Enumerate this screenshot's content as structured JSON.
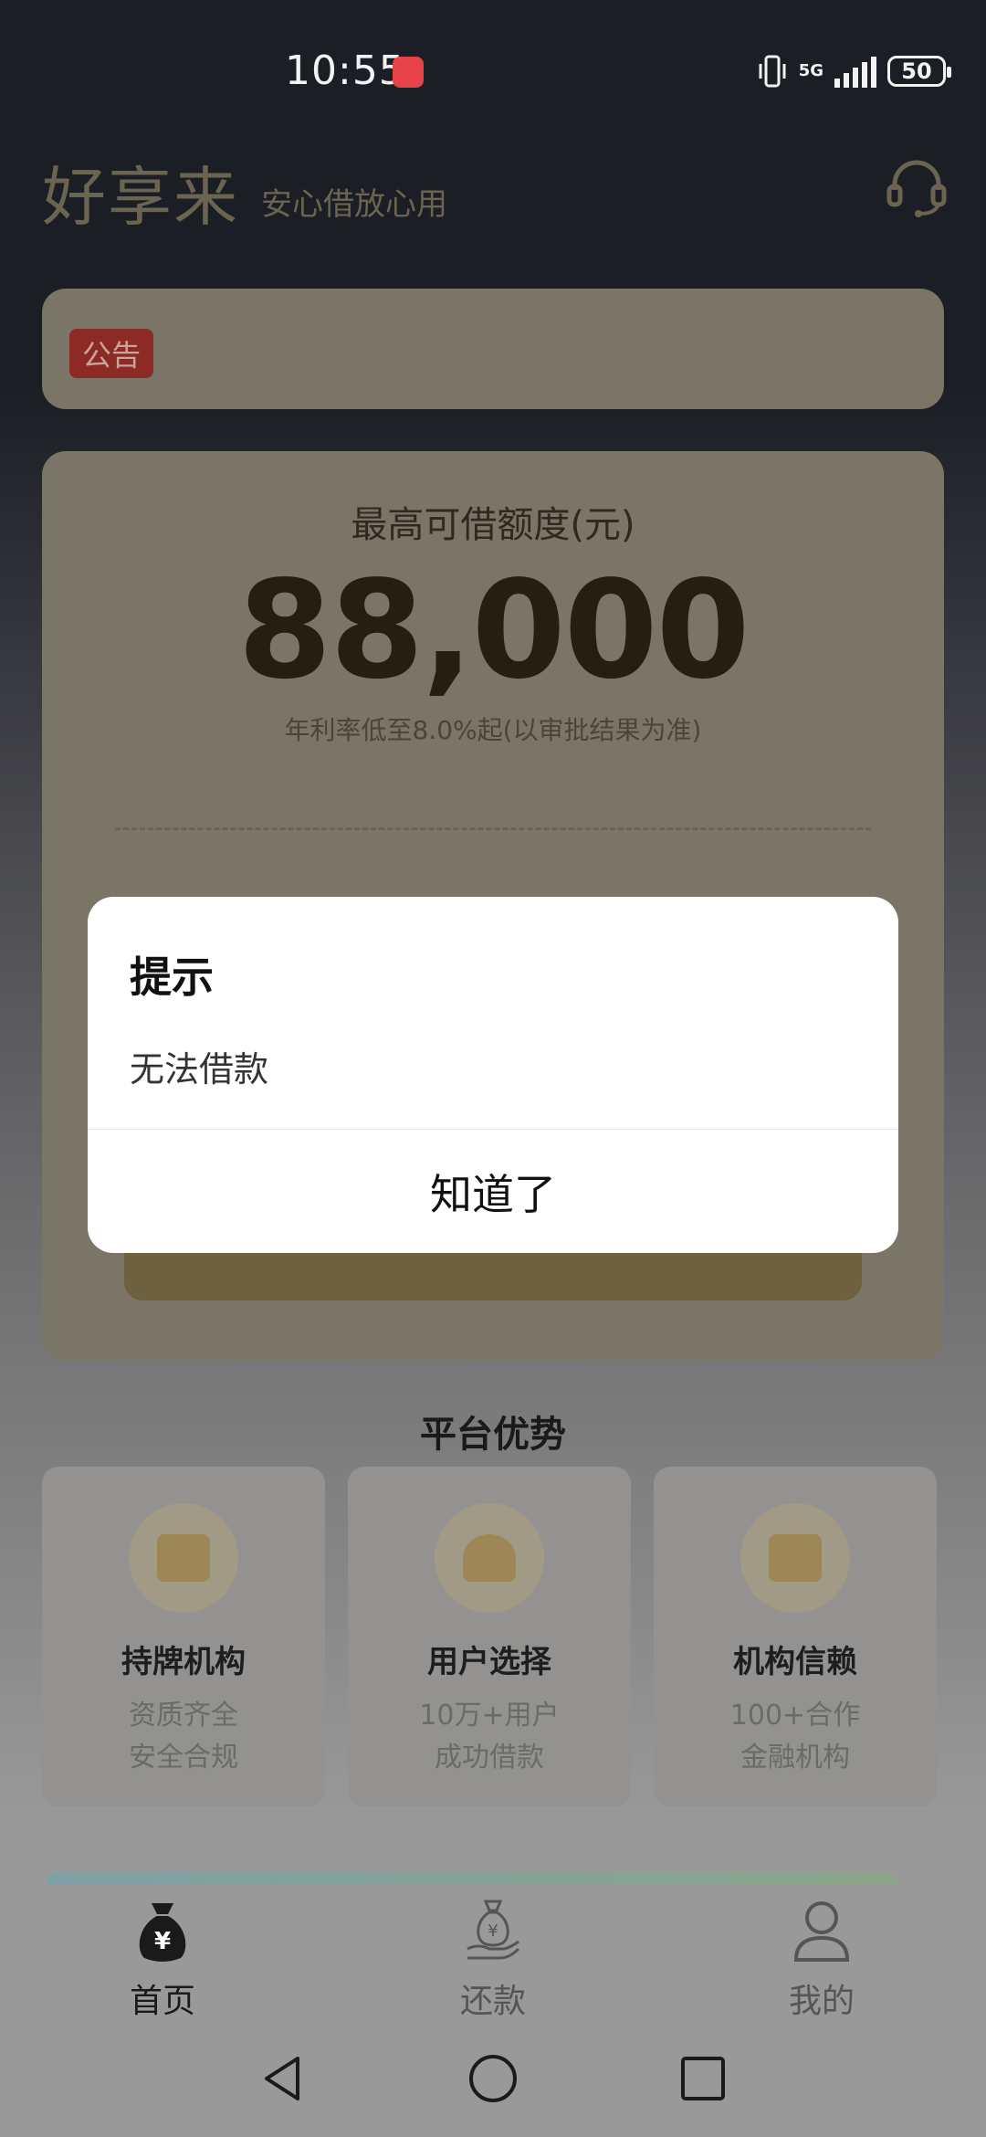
{
  "status_bar": {
    "time": "10:55",
    "network": "5G",
    "battery": "50"
  },
  "header": {
    "title": "好享来",
    "slogan": "安心借放心用",
    "support_icon": "headset-icon"
  },
  "notice": {
    "badge": "公告"
  },
  "credit": {
    "label": "最高可借额度(元)",
    "amount": "88,000",
    "rate_note": "年利率低至8.0%起(以审批结果为准)"
  },
  "advantages": {
    "title": "平台优势",
    "items": [
      {
        "title": "持牌机构",
        "desc1": "资质齐全",
        "desc2": "安全合规"
      },
      {
        "title": "用户选择",
        "desc1": "10万+用户",
        "desc2": "成功借款"
      },
      {
        "title": "机构信赖",
        "desc1": "100+合作",
        "desc2": "金融机构"
      }
    ]
  },
  "bottom_nav": {
    "items": [
      {
        "label": "首页",
        "icon": "money-bag-icon",
        "active": true
      },
      {
        "label": "还款",
        "icon": "repay-hand-icon",
        "active": false
      },
      {
        "label": "我的",
        "icon": "user-icon",
        "active": false
      }
    ]
  },
  "dialog": {
    "title": "提示",
    "message": "无法借款",
    "ok_label": "知道了"
  },
  "colors": {
    "dialog_bg": "#ffffff",
    "brand_gold": "#6b6450",
    "notice_red": "#8c2a26"
  }
}
